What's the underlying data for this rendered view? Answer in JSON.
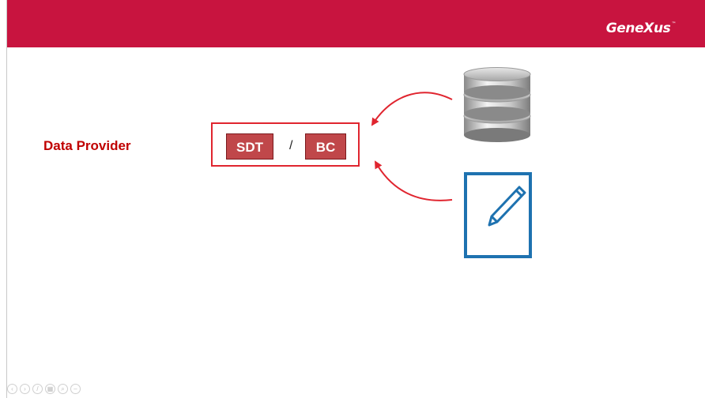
{
  "header": {
    "brand": "GeneXus",
    "brand_mark": "™",
    "bar_color": "#c8143f"
  },
  "main": {
    "label": "Data Provider",
    "items": [
      {
        "label": "SDT"
      },
      {
        "label": "BC"
      }
    ],
    "separator": "/",
    "icons": [
      "database-icon",
      "edit-document-icon"
    ]
  },
  "controls": {
    "icons": [
      "previous-icon",
      "next-icon",
      "pen-icon",
      "slides-icon",
      "zoom-icon",
      "more-icon"
    ],
    "glyphs": [
      "‹",
      "›",
      "/",
      "▦",
      "⌕",
      "–"
    ]
  }
}
